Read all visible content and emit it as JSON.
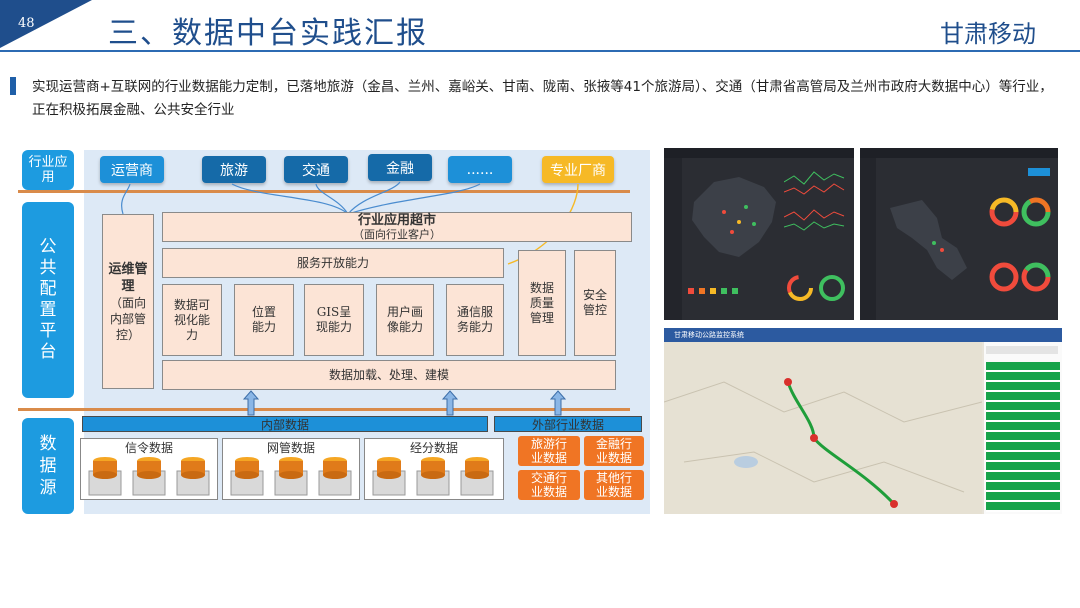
{
  "header": {
    "page_number": "48",
    "title": "三、数据中台实践汇报",
    "brand": "甘肃移动"
  },
  "intro": "实现运营商+互联网的行业数据能力定制，已落地旅游（金昌、兰州、嘉峪关、甘南、陇南、张掖等41个旅游局）、交通（甘肃省高管局及兰州市政府大数据中心）等行业，正在积极拓展金融、公共安全行业",
  "diagram": {
    "side_labels": {
      "industry_app": "行业应用",
      "public_platform": "公共配置平台",
      "data_source": "数据源"
    },
    "top_buttons": [
      "运营商",
      "旅游",
      "交通",
      "金融",
      "......",
      "专业厂商"
    ],
    "ops": "运维管理（面向内部管控）",
    "ops_title": "运维管理",
    "ops_sub": "（面向内部管控）",
    "market_title": "行业应用超市",
    "market_sub": "（面向行业客户）",
    "service_open": "服务开放能力",
    "capabilities": [
      "数据可视化能力",
      "位置能力",
      "GIS呈现能力",
      "用户画像能力",
      "通信服务能力"
    ],
    "quality": "数据质量管理",
    "security": "安全管控",
    "data_processing": "数据加载、处理、建模",
    "internal_data": "内部数据",
    "external_data": "外部行业数据",
    "sources": [
      "信令数据",
      "网管数据",
      "经分数据"
    ],
    "external_sources": [
      "旅游行业数据",
      "金融行业数据",
      "交通行业数据",
      "其他行业数据"
    ]
  },
  "screenshots": {
    "map_panel_title": "甘肃移动公路监控系统"
  },
  "colors": {
    "primary": "#1f4e8c",
    "accent_blue": "#1d90d8",
    "orange": "#f07524",
    "yellow": "#f6b926",
    "peach": "#fce4d6"
  }
}
